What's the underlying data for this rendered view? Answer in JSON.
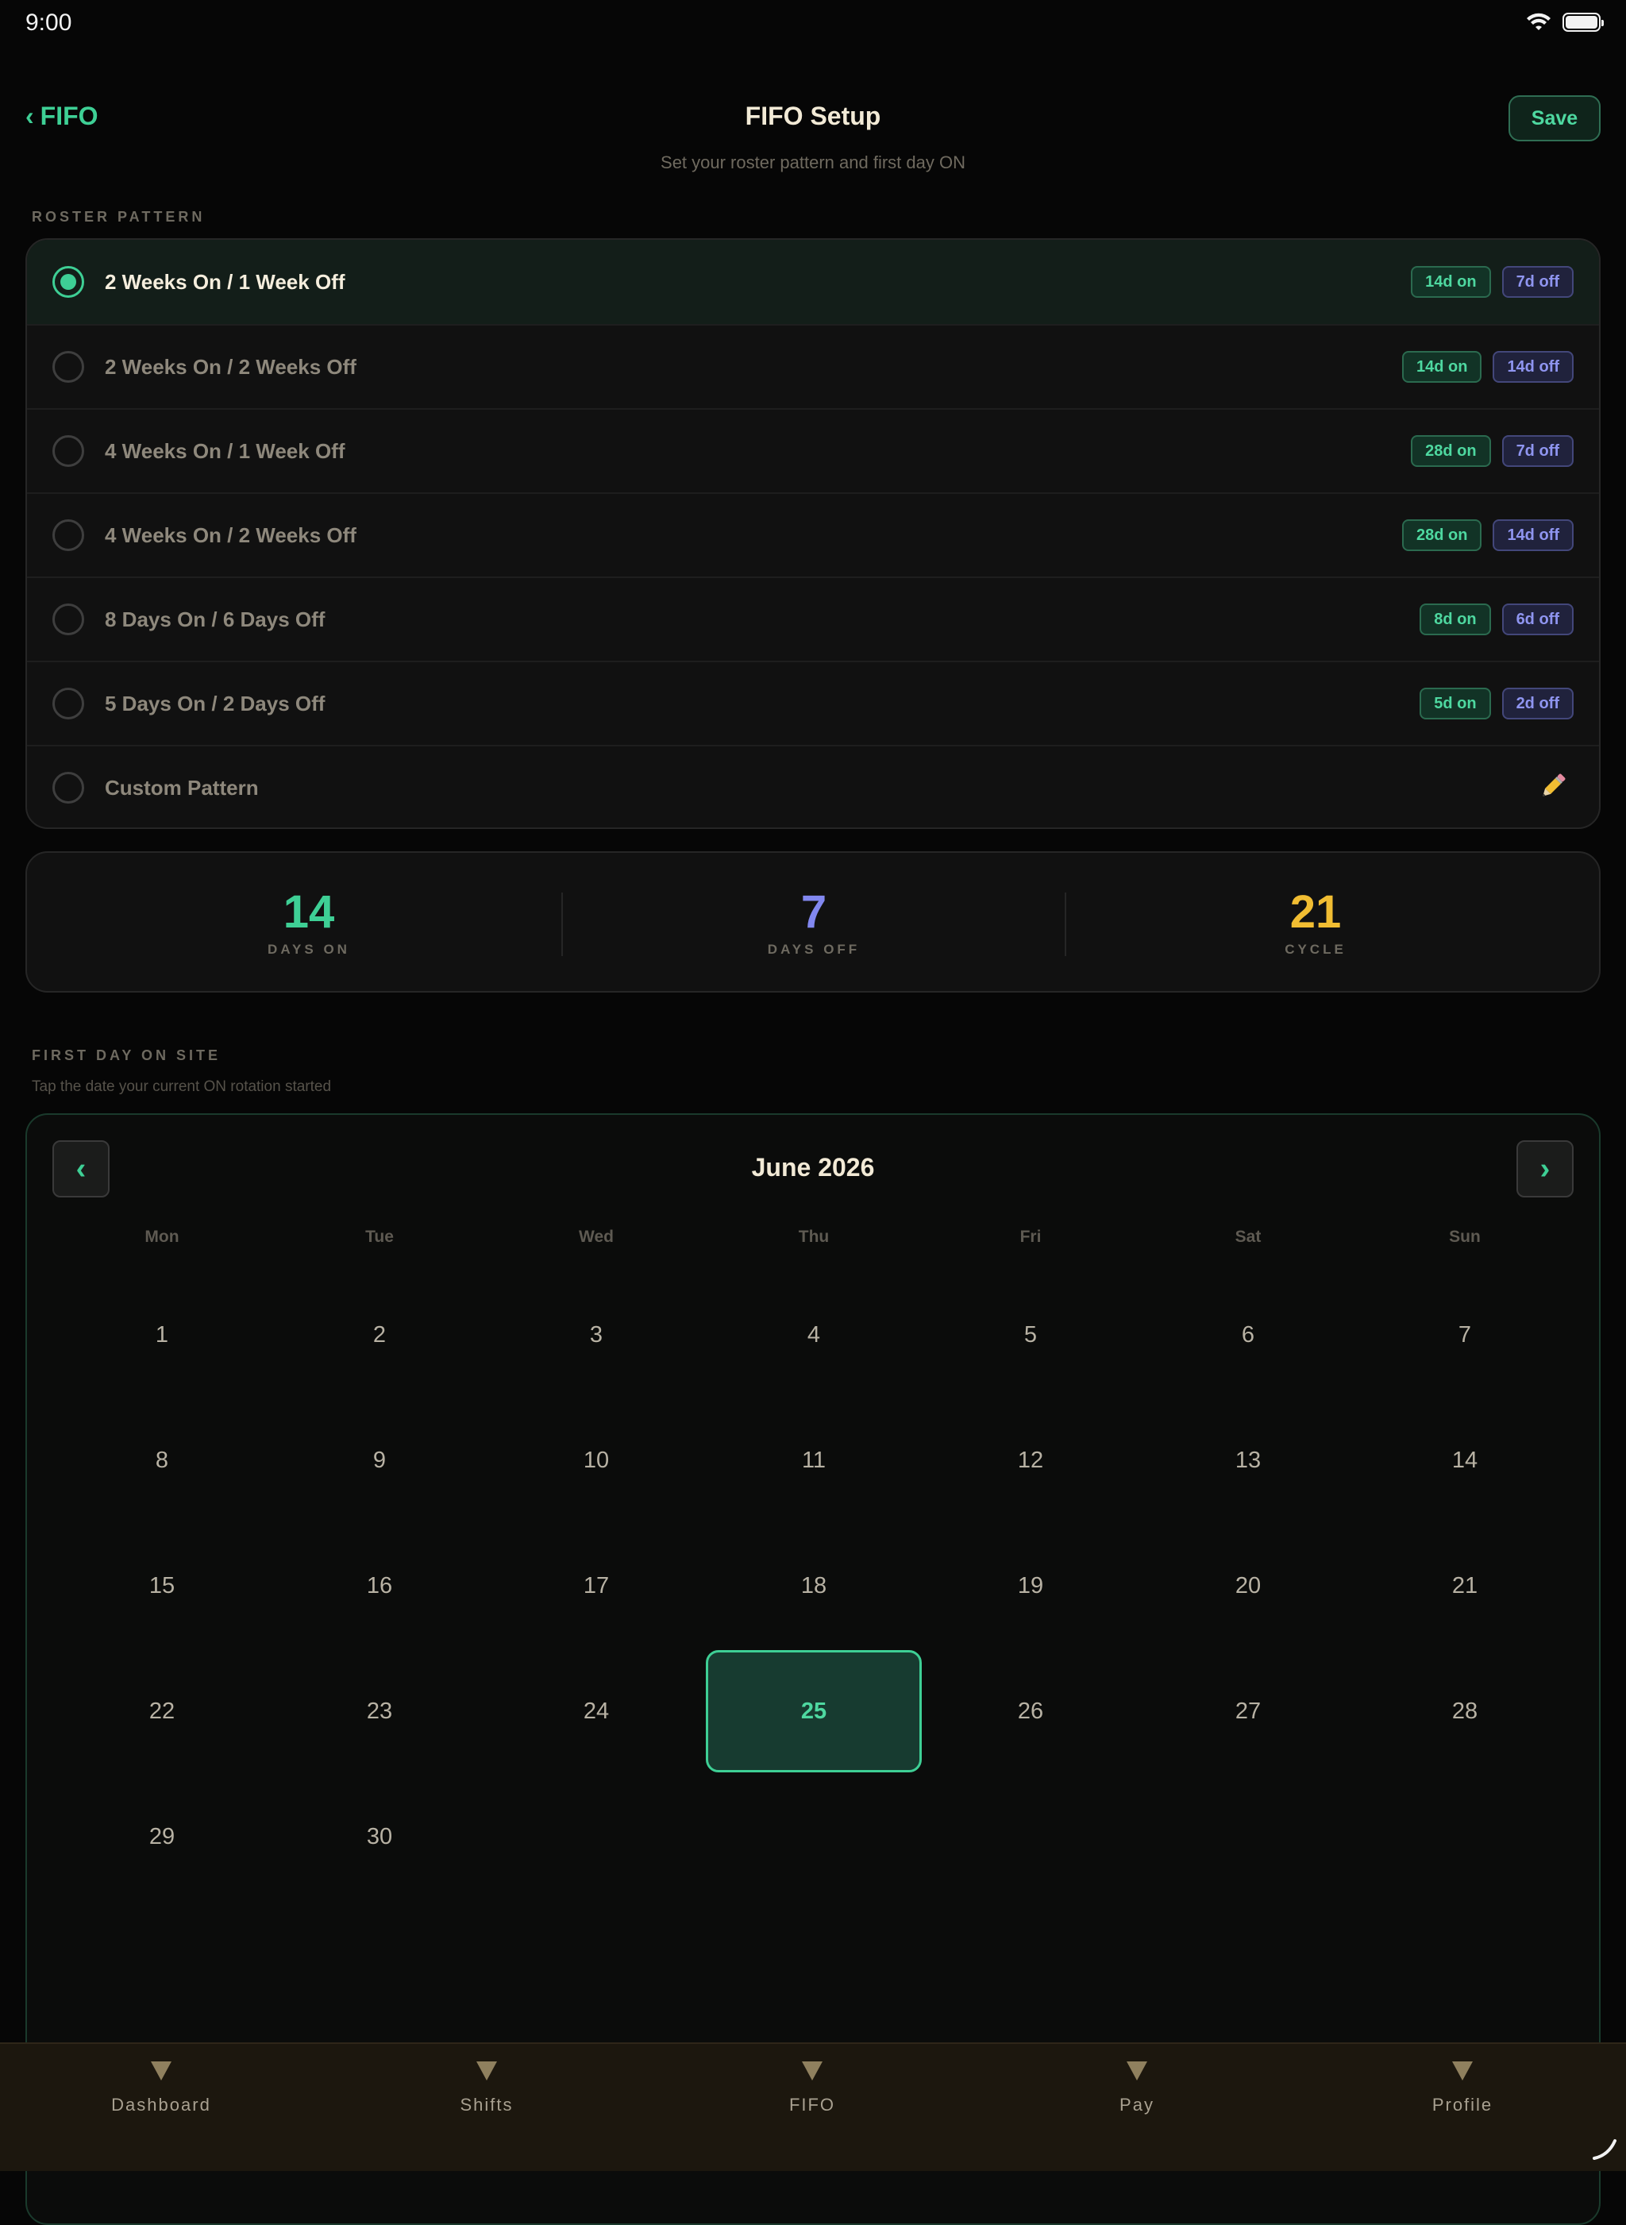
{
  "status_bar": {
    "time": "9:00"
  },
  "header": {
    "back_label": "FIFO",
    "title": "FIFO Setup",
    "subtitle": "Set your roster pattern and first day ON",
    "save_label": "Save"
  },
  "roster": {
    "section_label": "ROSTER PATTERN",
    "options": [
      {
        "label": "2 Weeks On / 1 Week Off",
        "on": "14d on",
        "off": "7d off",
        "selected": true
      },
      {
        "label": "2 Weeks On / 2 Weeks Off",
        "on": "14d on",
        "off": "14d off",
        "selected": false
      },
      {
        "label": "4 Weeks On / 1 Week Off",
        "on": "28d on",
        "off": "7d off",
        "selected": false
      },
      {
        "label": "4 Weeks On / 2 Weeks Off",
        "on": "28d on",
        "off": "14d off",
        "selected": false
      },
      {
        "label": "8 Days On / 6 Days Off",
        "on": "8d on",
        "off": "6d off",
        "selected": false
      },
      {
        "label": "5 Days On / 2 Days Off",
        "on": "5d on",
        "off": "2d off",
        "selected": false
      },
      {
        "label": "Custom Pattern",
        "icon": "pencil-icon",
        "selected": false
      }
    ]
  },
  "stats": {
    "days_on": {
      "value": "14",
      "label": "DAYS ON",
      "color": "#3ecf95"
    },
    "days_off": {
      "value": "7",
      "label": "DAYS OFF",
      "color": "#8288f0"
    },
    "cycle": {
      "value": "21",
      "label": "CYCLE",
      "color": "#f1bd32"
    }
  },
  "first_day": {
    "section_label": "FIRST DAY ON SITE",
    "hint": "Tap the date your current ON rotation started"
  },
  "calendar": {
    "month_label": "June 2026",
    "prev_icon": "‹",
    "next_icon": "›",
    "weekdays": [
      "Mon",
      "Tue",
      "Wed",
      "Thu",
      "Fri",
      "Sat",
      "Sun"
    ],
    "days": [
      "1",
      "2",
      "3",
      "4",
      "5",
      "6",
      "7",
      "8",
      "9",
      "10",
      "11",
      "12",
      "13",
      "14",
      "15",
      "16",
      "17",
      "18",
      "19",
      "20",
      "21",
      "22",
      "23",
      "24",
      "25",
      "26",
      "27",
      "28",
      "29",
      "30"
    ],
    "selected_day": "25"
  },
  "tabbar": {
    "tabs": [
      {
        "label": "Dashboard"
      },
      {
        "label": "Shifts"
      },
      {
        "label": "FIFO"
      },
      {
        "label": "Pay"
      },
      {
        "label": "Profile"
      }
    ]
  },
  "colors": {
    "accent": "#3ecf95",
    "off": "#8288f0",
    "cycle": "#f1bd32"
  }
}
